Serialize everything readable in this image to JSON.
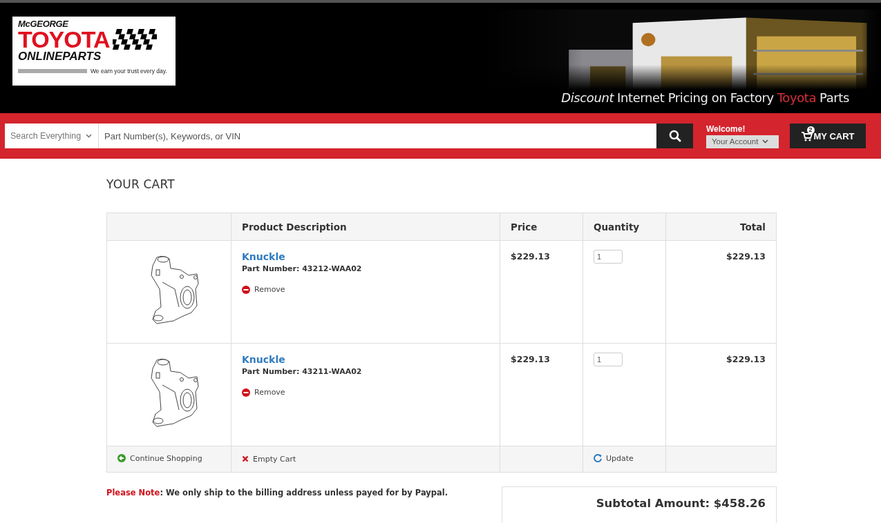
{
  "logo": {
    "top": "McGEORGE",
    "brand": "TOYOTA",
    "sub": "ONLINEPARTS",
    "slogan": "We earn your trust every day."
  },
  "banner": {
    "tagline": [
      {
        "text": "Discount",
        "kind": "italic"
      },
      {
        "text": "Internet Pricing on Factory",
        "kind": "plain"
      },
      {
        "text": "Toyota",
        "kind": "red"
      },
      {
        "text": "Parts",
        "kind": "plain"
      }
    ]
  },
  "search": {
    "scope": "Search Everything",
    "placeholder": "Part Number(s), Keywords, or VIN"
  },
  "account": {
    "welcome": "Welcome!",
    "label": "Your Account"
  },
  "cart_button": {
    "label": "MY CART",
    "count": "2"
  },
  "page_title": "YOUR CART",
  "table": {
    "columns": [
      "Product Description",
      "Price",
      "Quantity",
      "Total"
    ],
    "rows": [
      {
        "name": "Knuckle",
        "part_number": "Part Number: 43212-WAA02",
        "remove": "Remove",
        "price": "$229.13",
        "quantity": "1",
        "total": "$229.13"
      },
      {
        "name": "Knuckle",
        "part_number": "Part Number: 43211-WAA02",
        "remove": "Remove",
        "price": "$229.13",
        "quantity": "1",
        "total": "$229.13"
      }
    ],
    "actions": {
      "continue": "Continue Shopping",
      "empty": "Empty Cart",
      "update": "Update"
    }
  },
  "note": {
    "label": "Please Note",
    "text": ": We only ship to the billing address unless payed for by Paypal."
  },
  "subtotal": "Subtotal Amount: $458.26"
}
